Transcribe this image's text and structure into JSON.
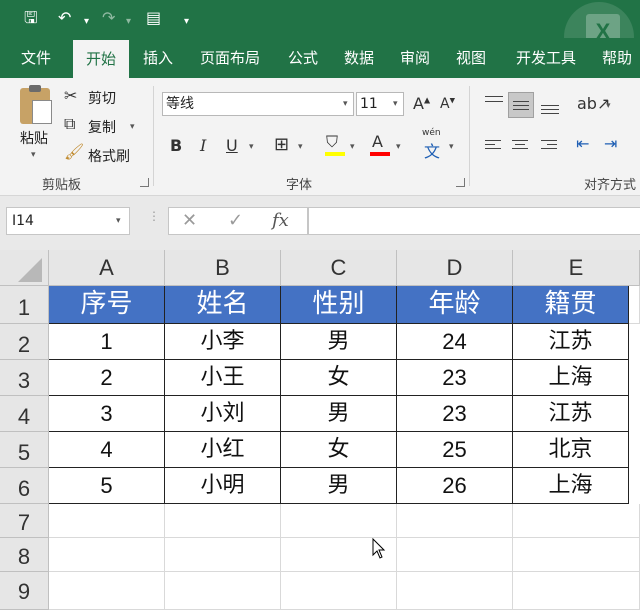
{
  "quick_access": {
    "save_icon": "save-icon",
    "undo_icon": "undo-icon",
    "redo_icon": "redo-icon",
    "form_icon": "form-icon",
    "customize_icon": "customize-icon"
  },
  "tabs": [
    {
      "label": "文件"
    },
    {
      "label": "开始"
    },
    {
      "label": "插入"
    },
    {
      "label": "页面布局"
    },
    {
      "label": "公式"
    },
    {
      "label": "数据"
    },
    {
      "label": "审阅"
    },
    {
      "label": "视图"
    },
    {
      "label": "开发工具"
    },
    {
      "label": "帮助"
    }
  ],
  "active_tab": "开始",
  "ribbon": {
    "clipboard": {
      "paste": "粘贴",
      "cut": "剪切",
      "copy": "复制",
      "format_painter": "格式刷",
      "group_label": "剪贴板"
    },
    "font": {
      "font_name": "等线",
      "font_size": "11",
      "group_label": "字体",
      "phonetic_label": "wén"
    },
    "alignment": {
      "group_label": "对齐方式"
    }
  },
  "formula_bar": {
    "name_box": "I14",
    "formula": ""
  },
  "columns": [
    "A",
    "B",
    "C",
    "D",
    "E"
  ],
  "rows": [
    "1",
    "2",
    "3",
    "4",
    "5",
    "6",
    "7",
    "8",
    "9"
  ],
  "table": {
    "headers": [
      "序号",
      "姓名",
      "性别",
      "年龄",
      "籍贯"
    ],
    "rows": [
      [
        "1",
        "小李",
        "男",
        "24",
        "江苏"
      ],
      [
        "2",
        "小王",
        "女",
        "23",
        "上海"
      ],
      [
        "3",
        "小刘",
        "男",
        "23",
        "江苏"
      ],
      [
        "4",
        "小红",
        "女",
        "25",
        "北京"
      ],
      [
        "5",
        "小明",
        "男",
        "26",
        "上海"
      ]
    ]
  },
  "colors": {
    "title_bar": "#217346",
    "header_fill": "#4472c4"
  }
}
